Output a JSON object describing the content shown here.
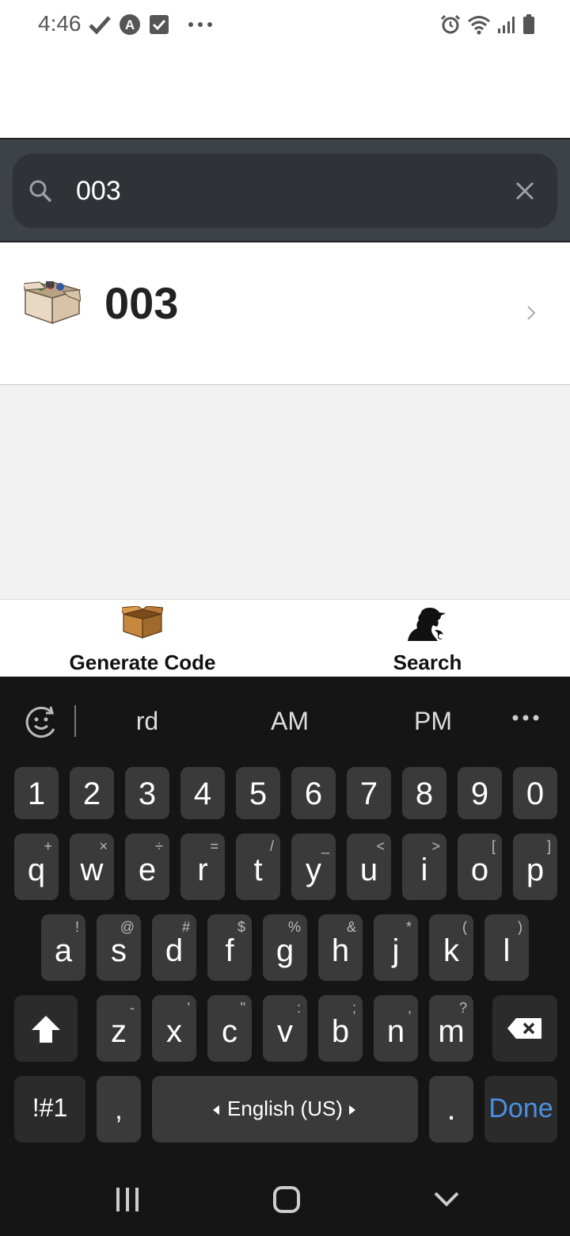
{
  "status": {
    "time": "4:46",
    "left_icons": [
      "check-icon",
      "at-icon",
      "checkbox-icon",
      "more-dots-icon"
    ],
    "right_icons": [
      "alarm-icon",
      "wifi-icon",
      "signal-icon",
      "battery-icon"
    ]
  },
  "search": {
    "value": "003",
    "placeholder": ""
  },
  "results": [
    {
      "title": "003"
    }
  ],
  "tabs": [
    {
      "label": "Generate Code",
      "icon": "box-icon"
    },
    {
      "label": "Search",
      "icon": "detective-icon"
    }
  ],
  "keyboard": {
    "suggestions": [
      "rd",
      "AM",
      "PM"
    ],
    "number_row": [
      "1",
      "2",
      "3",
      "4",
      "5",
      "6",
      "7",
      "8",
      "9",
      "0"
    ],
    "row1": [
      {
        "k": "q",
        "h": "+"
      },
      {
        "k": "w",
        "h": "×"
      },
      {
        "k": "e",
        "h": "÷"
      },
      {
        "k": "r",
        "h": "="
      },
      {
        "k": "t",
        "h": "/"
      },
      {
        "k": "y",
        "h": "_"
      },
      {
        "k": "u",
        "h": "<"
      },
      {
        "k": "i",
        "h": ">"
      },
      {
        "k": "o",
        "h": "["
      },
      {
        "k": "p",
        "h": "]"
      }
    ],
    "row2": [
      {
        "k": "a",
        "h": "!"
      },
      {
        "k": "s",
        "h": "@"
      },
      {
        "k": "d",
        "h": "#"
      },
      {
        "k": "f",
        "h": "$"
      },
      {
        "k": "g",
        "h": "%"
      },
      {
        "k": "h",
        "h": "&"
      },
      {
        "k": "j",
        "h": "*"
      },
      {
        "k": "k",
        "h": "("
      },
      {
        "k": "l",
        "h": ")"
      }
    ],
    "row3": [
      {
        "k": "z",
        "h": "-"
      },
      {
        "k": "x",
        "h": "'"
      },
      {
        "k": "c",
        "h": "\""
      },
      {
        "k": "v",
        "h": ":"
      },
      {
        "k": "b",
        "h": ";"
      },
      {
        "k": "n",
        "h": ","
      },
      {
        "k": "m",
        "h": "?"
      }
    ],
    "symbols_label": "!#1",
    "comma_label": ",",
    "space_label": "English (US)",
    "period_label": ".",
    "done_label": "Done",
    "done_color": "#4a90e2"
  },
  "colors": {
    "search_bar_bg": "#3d4246",
    "keyboard_bg": "#151515",
    "key_bg": "#3a3a3a"
  }
}
